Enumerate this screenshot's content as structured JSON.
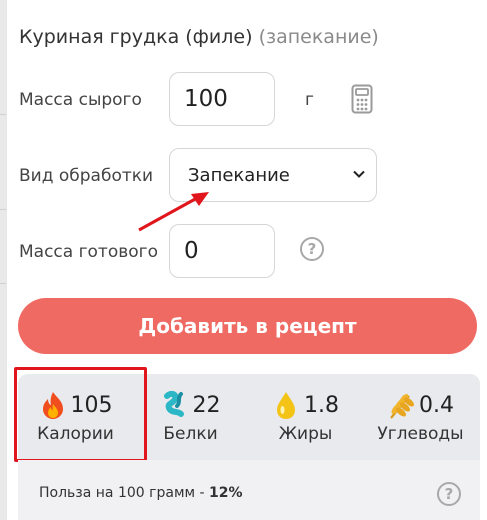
{
  "title": {
    "name": "Куриная грудка (филе)",
    "method": "(запекание)"
  },
  "raw_mass": {
    "label": "Масса сырого",
    "value": "100",
    "unit": "г"
  },
  "processing": {
    "label": "Вид обработки",
    "selected": "Запекание"
  },
  "cooked_mass": {
    "label": "Масса готового",
    "value": "0"
  },
  "add_button": {
    "label": "Добавить в рецепт"
  },
  "nutrients": [
    {
      "value": "105",
      "label": "Калории",
      "icon": "flame-icon"
    },
    {
      "value": "22",
      "label": "Белки",
      "icon": "protein-icon"
    },
    {
      "value": "1.8",
      "label": "Жиры",
      "icon": "fat-drop-icon"
    },
    {
      "value": "0.4",
      "label": "Углеводы",
      "icon": "wheat-icon"
    }
  ],
  "benefit": {
    "text": "Польза на 100 грамм - ",
    "percent": "12%"
  },
  "colors": {
    "accent": "#ef6a62",
    "highlight": "#e0161c",
    "arrow": "#e0161c"
  }
}
